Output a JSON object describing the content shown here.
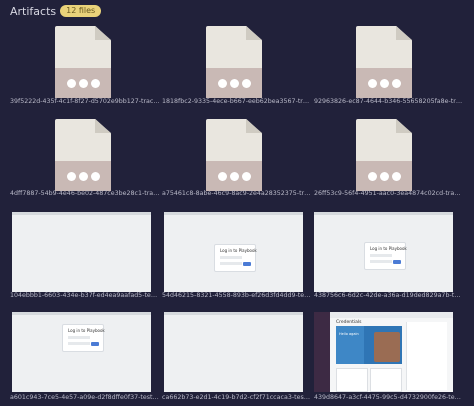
{
  "header": {
    "title": "Artifacts",
    "badge": "12 files"
  },
  "items": [
    {
      "caption": "39f5222d-435f-4c1f-8f27-d5702e9bb127-trace..."
    },
    {
      "caption": "1818fbc2-9335-4ece-b667-eeb62bea3567-trace..."
    },
    {
      "caption": "92963826-ec87-4644-b346-55658205fa8e-trace..."
    },
    {
      "caption": "4dff7887-54b9-4e46-be02-487ce3be28c1-trac..."
    },
    {
      "caption": "a75461c8-8abe-46c9-8ac9-2e4a28352375-trac..."
    },
    {
      "caption": "26ff53c9-56f4-4951-aac0-3ea4874c02cd-trace..."
    },
    {
      "caption": "104ebbb1-6603-434e-b37f-ed4ea9aafad5-test-..."
    },
    {
      "caption": "54d46215-8321-4558-893b-ef26d3fd4dd9-test-..."
    },
    {
      "caption": "438756c6-6d2c-42de-a36a-d19ded829a7b-tes..."
    },
    {
      "caption": "a601c943-7ce5-4e57-a09e-d2f8dffe0f37-test-f..."
    },
    {
      "caption": "ca662b73-e2d1-4c19-b7d2-cf2f71ccaca3-test-..."
    },
    {
      "caption": "439d8647-a3cf-4475-99c5-d4732900fe26-test-..."
    }
  ],
  "login": {
    "title": "Log in to Playbook"
  },
  "slack": {
    "heading": "Credentials",
    "hero_text": "Hello again"
  },
  "colors": {
    "background": "#21213a",
    "badge": "#e9d27a",
    "file_band": "#c9b9b5"
  }
}
